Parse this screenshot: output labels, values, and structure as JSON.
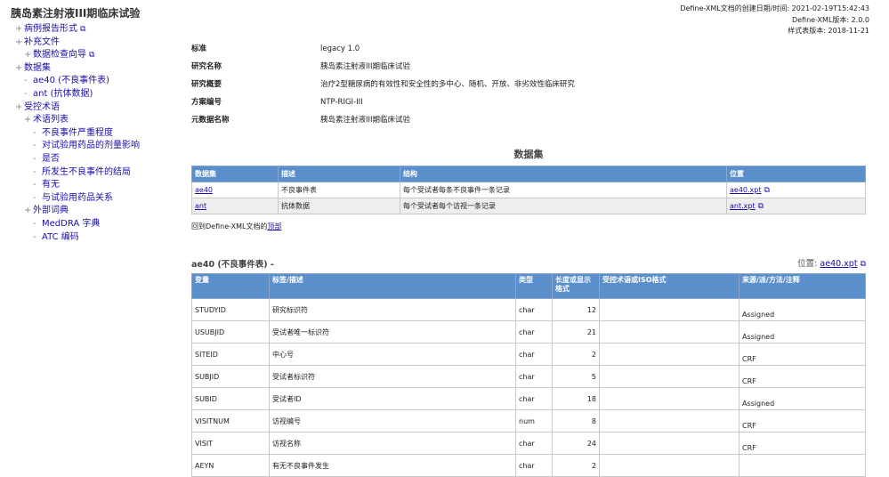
{
  "app_title": "胰岛素注射液III期临床试验",
  "sidebar": {
    "items": [
      {
        "marker": "+",
        "label": "病例报告形式",
        "level": 0,
        "ext": true
      },
      {
        "marker": "+",
        "label": "补充文件",
        "level": 0
      },
      {
        "marker": "+",
        "label": "数据检查向导",
        "level": 1,
        "ext": true
      },
      {
        "marker": "+",
        "label": "数据集",
        "level": 0
      },
      {
        "marker": "-",
        "label": "ae40 (不良事件表)",
        "level": 1
      },
      {
        "marker": "-",
        "label": "ant (抗体数据)",
        "level": 1
      },
      {
        "marker": "+",
        "label": "受控术语",
        "level": 0
      },
      {
        "marker": "+",
        "label": "术语列表",
        "level": 1
      },
      {
        "marker": "-",
        "label": "不良事件严重程度",
        "level": 2
      },
      {
        "marker": "-",
        "label": "对试验用药品的剂量影响",
        "level": 2
      },
      {
        "marker": "-",
        "label": "是否",
        "level": 2
      },
      {
        "marker": "-",
        "label": "所发生不良事件的结局",
        "level": 2
      },
      {
        "marker": "-",
        "label": "有无",
        "level": 2
      },
      {
        "marker": "-",
        "label": "与试验用药品关系",
        "level": 2
      },
      {
        "marker": "+",
        "label": "外部词典",
        "level": 1
      },
      {
        "marker": "-",
        "label": "MedDRA 字典",
        "level": 2
      },
      {
        "marker": "-",
        "label": "ATC 编码",
        "level": 2
      }
    ]
  },
  "meta": {
    "created": "Define-XML文档的创建日期/时间: 2021-02-19T15:42:43",
    "version": "Define-XML版本: 2.0.0",
    "stylesheet": "样式表版本: 2018-11-21"
  },
  "study_info": [
    {
      "key": "标准",
      "value": "legacy 1.0"
    },
    {
      "key": "研究名称",
      "value": "胰岛素注射液III期临床试验"
    },
    {
      "key": "研究概要",
      "value": "治疗2型糖尿病的有效性和安全性的多中心、随机、开放、非劣效性临床研究"
    },
    {
      "key": "方案编号",
      "value": "NTP-RIGI-III"
    },
    {
      "key": "元数据名称",
      "value": "胰岛素注射液III期临床试验"
    }
  ],
  "datasets": {
    "heading": "数据集",
    "headers": [
      "数据集",
      "描述",
      "结构",
      "位置"
    ],
    "rows": [
      {
        "name": "ae40",
        "desc": "不良事件表",
        "structure": "每个受试者每条不良事件一条记录",
        "location": "ae40.xpt"
      },
      {
        "name": "ant",
        "desc": "抗体数据",
        "structure": "每个受试者每个访视一条记录",
        "location": "ant.xpt"
      }
    ]
  },
  "back_link": {
    "prefix": "回到Define-XML文档的",
    "link": "顶部"
  },
  "ae40": {
    "heading": "ae40 (不良事件表) -",
    "location_label": "位置:",
    "location_link": "ae40.xpt",
    "headers": [
      "变量",
      "标签/描述",
      "类型",
      "长度或显示格式",
      "受控术语或ISO格式",
      "来源/派/方法/注释"
    ],
    "rows": [
      {
        "var": "STUDYID",
        "label": "研究标识符",
        "type": "char",
        "len": "12",
        "ct": "",
        "src": "Assigned"
      },
      {
        "var": "USUBJID",
        "label": "受试者唯一标识符",
        "type": "char",
        "len": "21",
        "ct": "",
        "src": "Assigned"
      },
      {
        "var": "SITEID",
        "label": "中心号",
        "type": "char",
        "len": "2",
        "ct": "",
        "src": "CRF"
      },
      {
        "var": "SUBJID",
        "label": "受试者标识符",
        "type": "char",
        "len": "5",
        "ct": "",
        "src": "CRF"
      },
      {
        "var": "SUBID",
        "label": "受试者ID",
        "type": "char",
        "len": "18",
        "ct": "",
        "src": "Assigned"
      },
      {
        "var": "VISITNUM",
        "label": "访视编号",
        "type": "num",
        "len": "8",
        "ct": "",
        "src": "CRF"
      },
      {
        "var": "VISIT",
        "label": "访视名称",
        "type": "char",
        "len": "24",
        "ct": "",
        "src": "CRF"
      },
      {
        "var": "AEYN",
        "label": "有无不良事件发生",
        "type": "char",
        "len": "2",
        "ct": "",
        "src": ""
      }
    ]
  }
}
